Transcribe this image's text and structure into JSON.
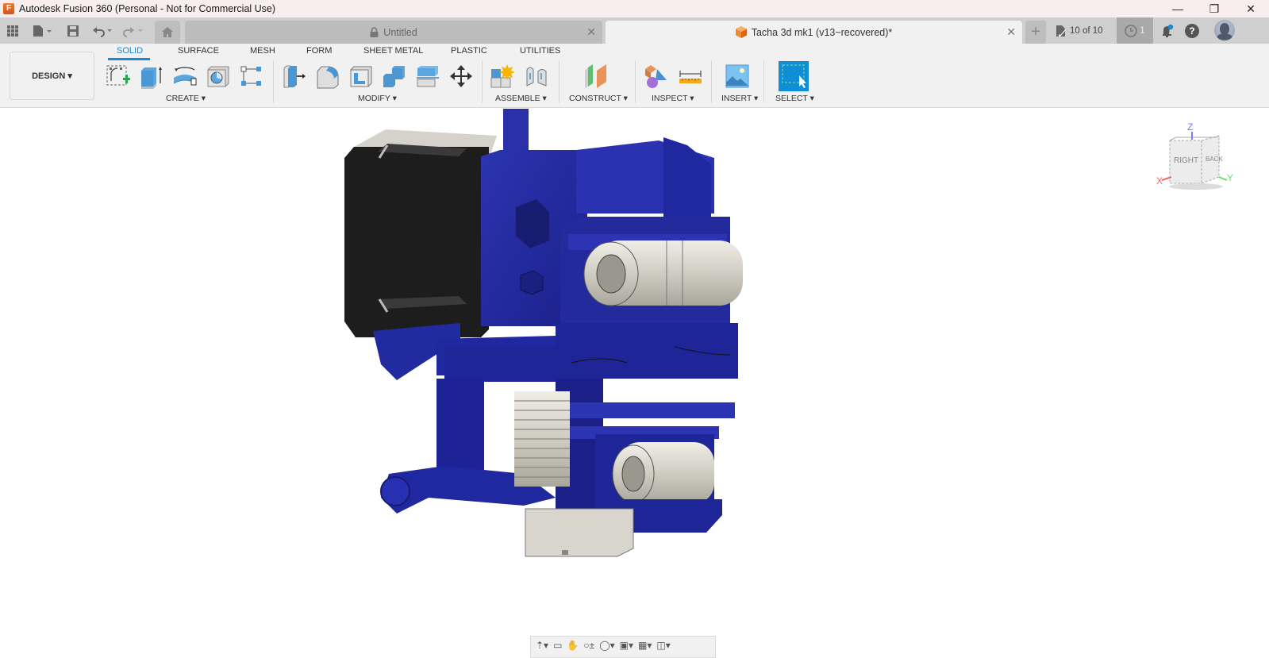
{
  "window": {
    "title": "Autodesk Fusion 360 (Personal - Not for Commercial Use)",
    "app_icon_label": "F",
    "controls": {
      "minimize": "—",
      "maximize": "❐",
      "close": "✕"
    }
  },
  "tabstrip": {
    "tabs": [
      {
        "label": "Untitled",
        "icon": "lock-icon",
        "active": false
      },
      {
        "label": "Tacha 3d mk1 (v13~recovered)*",
        "icon": "component-cube-icon",
        "active": true
      }
    ],
    "close_glyph": "✕",
    "new_tab_glyph": "+",
    "version_count": "10 of 10",
    "jobs_count": "1",
    "help_glyph": "?"
  },
  "ribbon": {
    "workspace": "DESIGN",
    "tabs": [
      "SOLID",
      "SURFACE",
      "MESH",
      "FORM",
      "SHEET METAL",
      "PLASTIC",
      "UTILITIES"
    ],
    "active_tab": "SOLID",
    "groups": [
      {
        "label": "CREATE",
        "tools": [
          "create-sketch",
          "extrude",
          "revolve",
          "hole",
          "pattern"
        ]
      },
      {
        "label": "MODIFY",
        "tools": [
          "press-pull",
          "fillet",
          "shell",
          "combine",
          "split-body",
          "move-copy"
        ]
      },
      {
        "label": "ASSEMBLE",
        "tools": [
          "new-component",
          "joint"
        ]
      },
      {
        "label": "CONSTRUCT",
        "tools": [
          "offset-plane"
        ]
      },
      {
        "label": "INSPECT",
        "tools": [
          "display-component-colors",
          "measure"
        ]
      },
      {
        "label": "INSERT",
        "tools": [
          "insert-image"
        ]
      },
      {
        "label": "SELECT",
        "tools": [
          "window-select"
        ]
      }
    ],
    "dropdown_glyph": "▾"
  },
  "viewcube": {
    "faces": {
      "front": "RIGHT",
      "side": "BACK"
    },
    "axes": {
      "x": "X",
      "y": "Y",
      "z": "Z"
    },
    "axis_colors": {
      "x": "#f06a6a",
      "y": "#6ae06a",
      "z": "#7a7aff"
    }
  },
  "colors": {
    "accent": "#1a8ad4",
    "model_blue": "#232a9c",
    "motor_black": "#1c1c1c",
    "bearing_silver": "#d8d6cc"
  }
}
